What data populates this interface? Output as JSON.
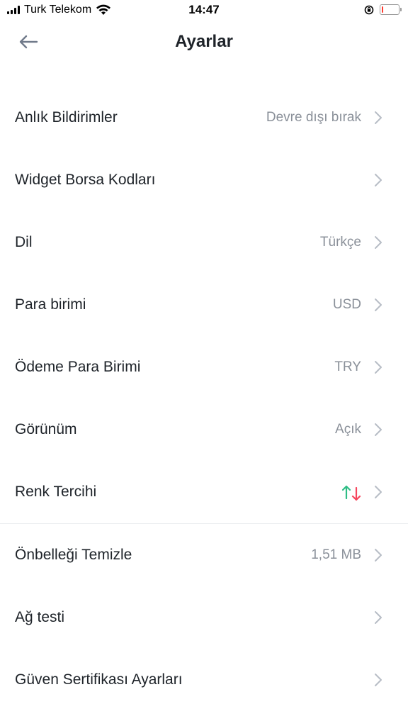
{
  "status_bar": {
    "carrier": "Turk Telekom",
    "time": "14:47",
    "battery_level": 0.1,
    "battery_color": "#ff3b30"
  },
  "header": {
    "title": "Ayarlar",
    "back_icon": "arrow-left-icon"
  },
  "settings": {
    "items": [
      {
        "label": "Anlık Bildirimler",
        "value": "Devre dışı bırak"
      },
      {
        "label": "Widget Borsa Kodları",
        "value": ""
      },
      {
        "label": "Dil",
        "value": "Türkçe"
      },
      {
        "label": "Para birimi",
        "value": "USD"
      },
      {
        "label": "Ödeme Para Birimi",
        "value": "TRY"
      },
      {
        "label": "Görünüm",
        "value": "Açık"
      },
      {
        "label": "Renk Tercihi",
        "value_icon": "up-green-down-red-arrows-icon"
      },
      {
        "label": "Önbelleği Temizle",
        "value": "1,51 MB"
      },
      {
        "label": "Ağ testi",
        "value": ""
      },
      {
        "label": "Güven Sertifikası Ayarları",
        "value": ""
      }
    ]
  },
  "colors": {
    "up": "#2ebd85",
    "down": "#f6465d",
    "chevron": "#b7bdc6",
    "text_primary": "#1e2329",
    "text_secondary": "#8a9099"
  }
}
